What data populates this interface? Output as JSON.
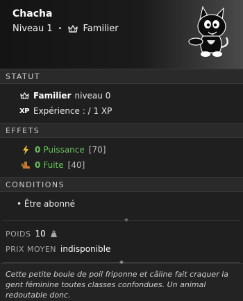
{
  "header": {
    "name": "Chacha",
    "level": "Niveau 1",
    "separator": "•",
    "type": "Familier",
    "portrait_icon": "black-cat-portrait"
  },
  "statut": {
    "title": "STATUT",
    "familier_label": "Familier",
    "familier_level": "niveau 0",
    "xp_icon": "XP",
    "xp_text": "Expérience :  / 1 XP"
  },
  "effets": {
    "title": "EFFETS",
    "items": [
      {
        "value": "0",
        "name": "Puissance",
        "bracket": "[70]",
        "icon": "lightning-icon"
      },
      {
        "value": "0",
        "name": "Fuite",
        "bracket": "[40]",
        "icon": "boot-icon"
      }
    ]
  },
  "conditions": {
    "title": "CONDITIONS",
    "items": [
      {
        "text": "• Être abonné"
      }
    ]
  },
  "meta": {
    "poids_label": "POIDS",
    "poids_value": "10",
    "prix_label": "PRIX MOYEN",
    "prix_value": "indisponible"
  },
  "description": "Cette petite boule de poil friponne et câline fait craquer la gent féminine toutes classes confondues. Un animal redoutable donc.",
  "colors": {
    "accent_green": "#66c05a",
    "background": "#1f1f1f",
    "section_header": "#2a2a2a"
  }
}
